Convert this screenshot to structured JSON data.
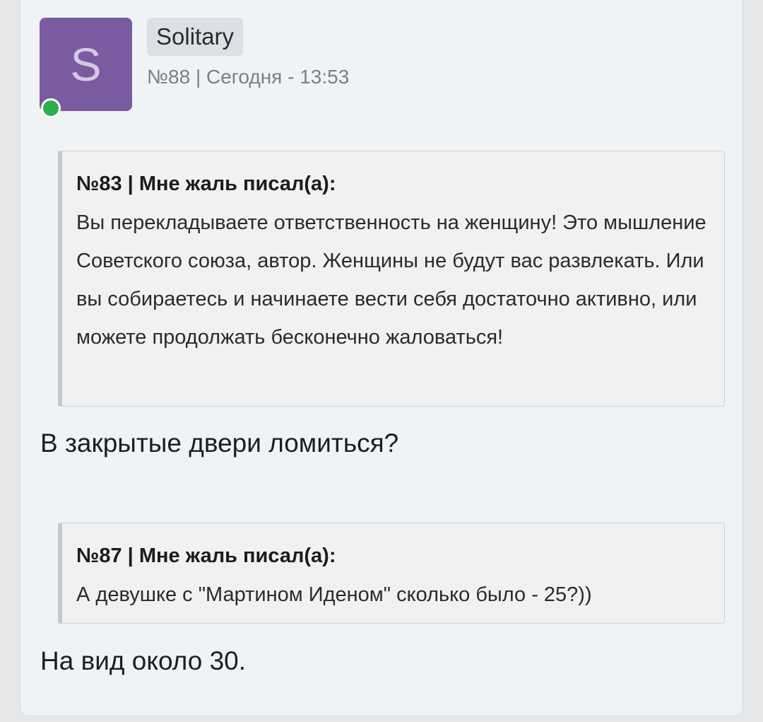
{
  "post": {
    "avatar_letter": "S",
    "avatar_color": "#7b5ba0",
    "online_status_color": "#2eae4c",
    "username": "Solitary",
    "meta": "№88 | Сегодня - 13:53"
  },
  "quotes": [
    {
      "header": "№83 | Мне жаль писал(а):",
      "body": "Вы перекладываете ответственность на женщину! Это мышление Советского союза, автор. Женщины не будут вас развлекать. Или вы собираетесь и начинаете вести себя достаточно активно, или можете продолжать бесконечно жаловаться!"
    },
    {
      "header": "№87 | Мне жаль писал(а):",
      "body": "А девушке с \"Мартином Иденом\" сколько было - 25?))"
    }
  ],
  "replies": [
    "В закрытые двери ломиться?",
    "На вид около 30."
  ]
}
